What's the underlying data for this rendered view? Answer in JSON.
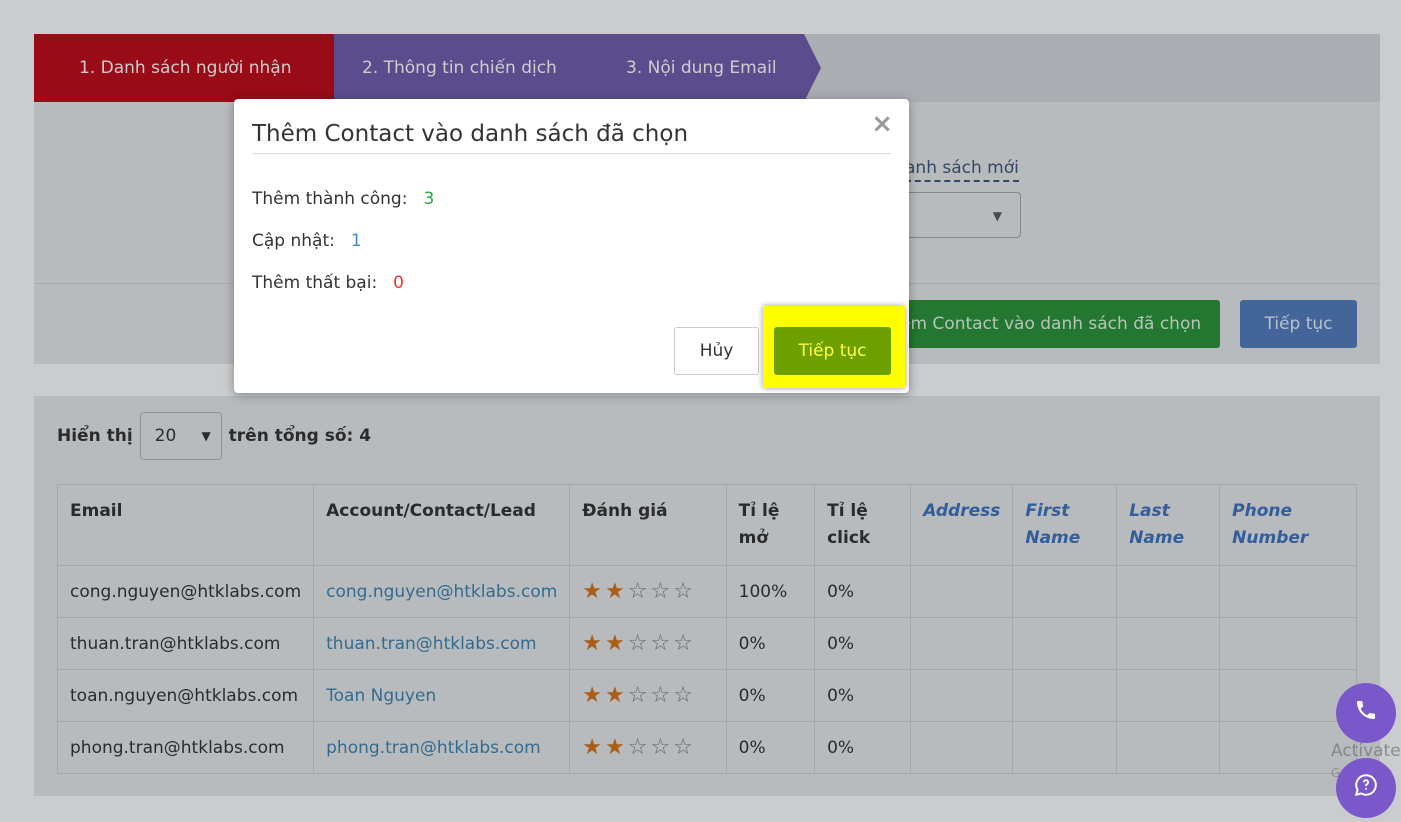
{
  "stepper": {
    "steps": [
      "1. Danh sách người nhận",
      "2. Thông tin chiến dịch",
      "3. Nội dung Email"
    ]
  },
  "background_form": {
    "new_list_link": "anh sách mới",
    "add_button": "em Contact vào danh sách đã chọn",
    "next_button": "Tiếp tục"
  },
  "pager": {
    "show_label": "Hiển thị",
    "page_size": "20",
    "total_label": "trên tổng số: 4"
  },
  "table": {
    "headers": [
      "Email",
      "Account/Contact/Lead",
      "Đánh giá",
      "Tỉ lệ mở",
      "Tỉ lệ click",
      "Address",
      "First Name",
      "Last Name",
      "Phone Number"
    ],
    "rows": [
      {
        "email": "cong.nguyen@htklabs.com",
        "account": "cong.nguyen@htklabs.com",
        "rating": 2,
        "open_rate": "100%",
        "click_rate": "0%"
      },
      {
        "email": "thuan.tran@htklabs.com",
        "account": "thuan.tran@htklabs.com",
        "rating": 2,
        "open_rate": "0%",
        "click_rate": "0%"
      },
      {
        "email": "toan.nguyen@htklabs.com",
        "account": "Toan Nguyen",
        "rating": 2,
        "open_rate": "0%",
        "click_rate": "0%"
      },
      {
        "email": "phong.tran@htklabs.com",
        "account": "phong.tran@htklabs.com",
        "rating": 2,
        "open_rate": "0%",
        "click_rate": "0%"
      }
    ],
    "rating_max": 5
  },
  "modal": {
    "title": "Thêm Contact vào danh sách đã chọn",
    "close_icon": "×",
    "stats": [
      {
        "label": "Thêm thành công:",
        "value": "3",
        "color": "#27a844"
      },
      {
        "label": "Cập nhật:",
        "value": "1",
        "color": "#3a8fd6"
      },
      {
        "label": "Thêm thất bại:",
        "value": "0",
        "color": "#e03b3b"
      }
    ],
    "cancel_label": "Hủy",
    "continue_label": "Tiếp tục"
  },
  "watermark": {
    "title": "Activate",
    "subtitle": "Go to Sett"
  },
  "icons": {
    "phone": "phone-icon",
    "chat": "chat-icon"
  }
}
